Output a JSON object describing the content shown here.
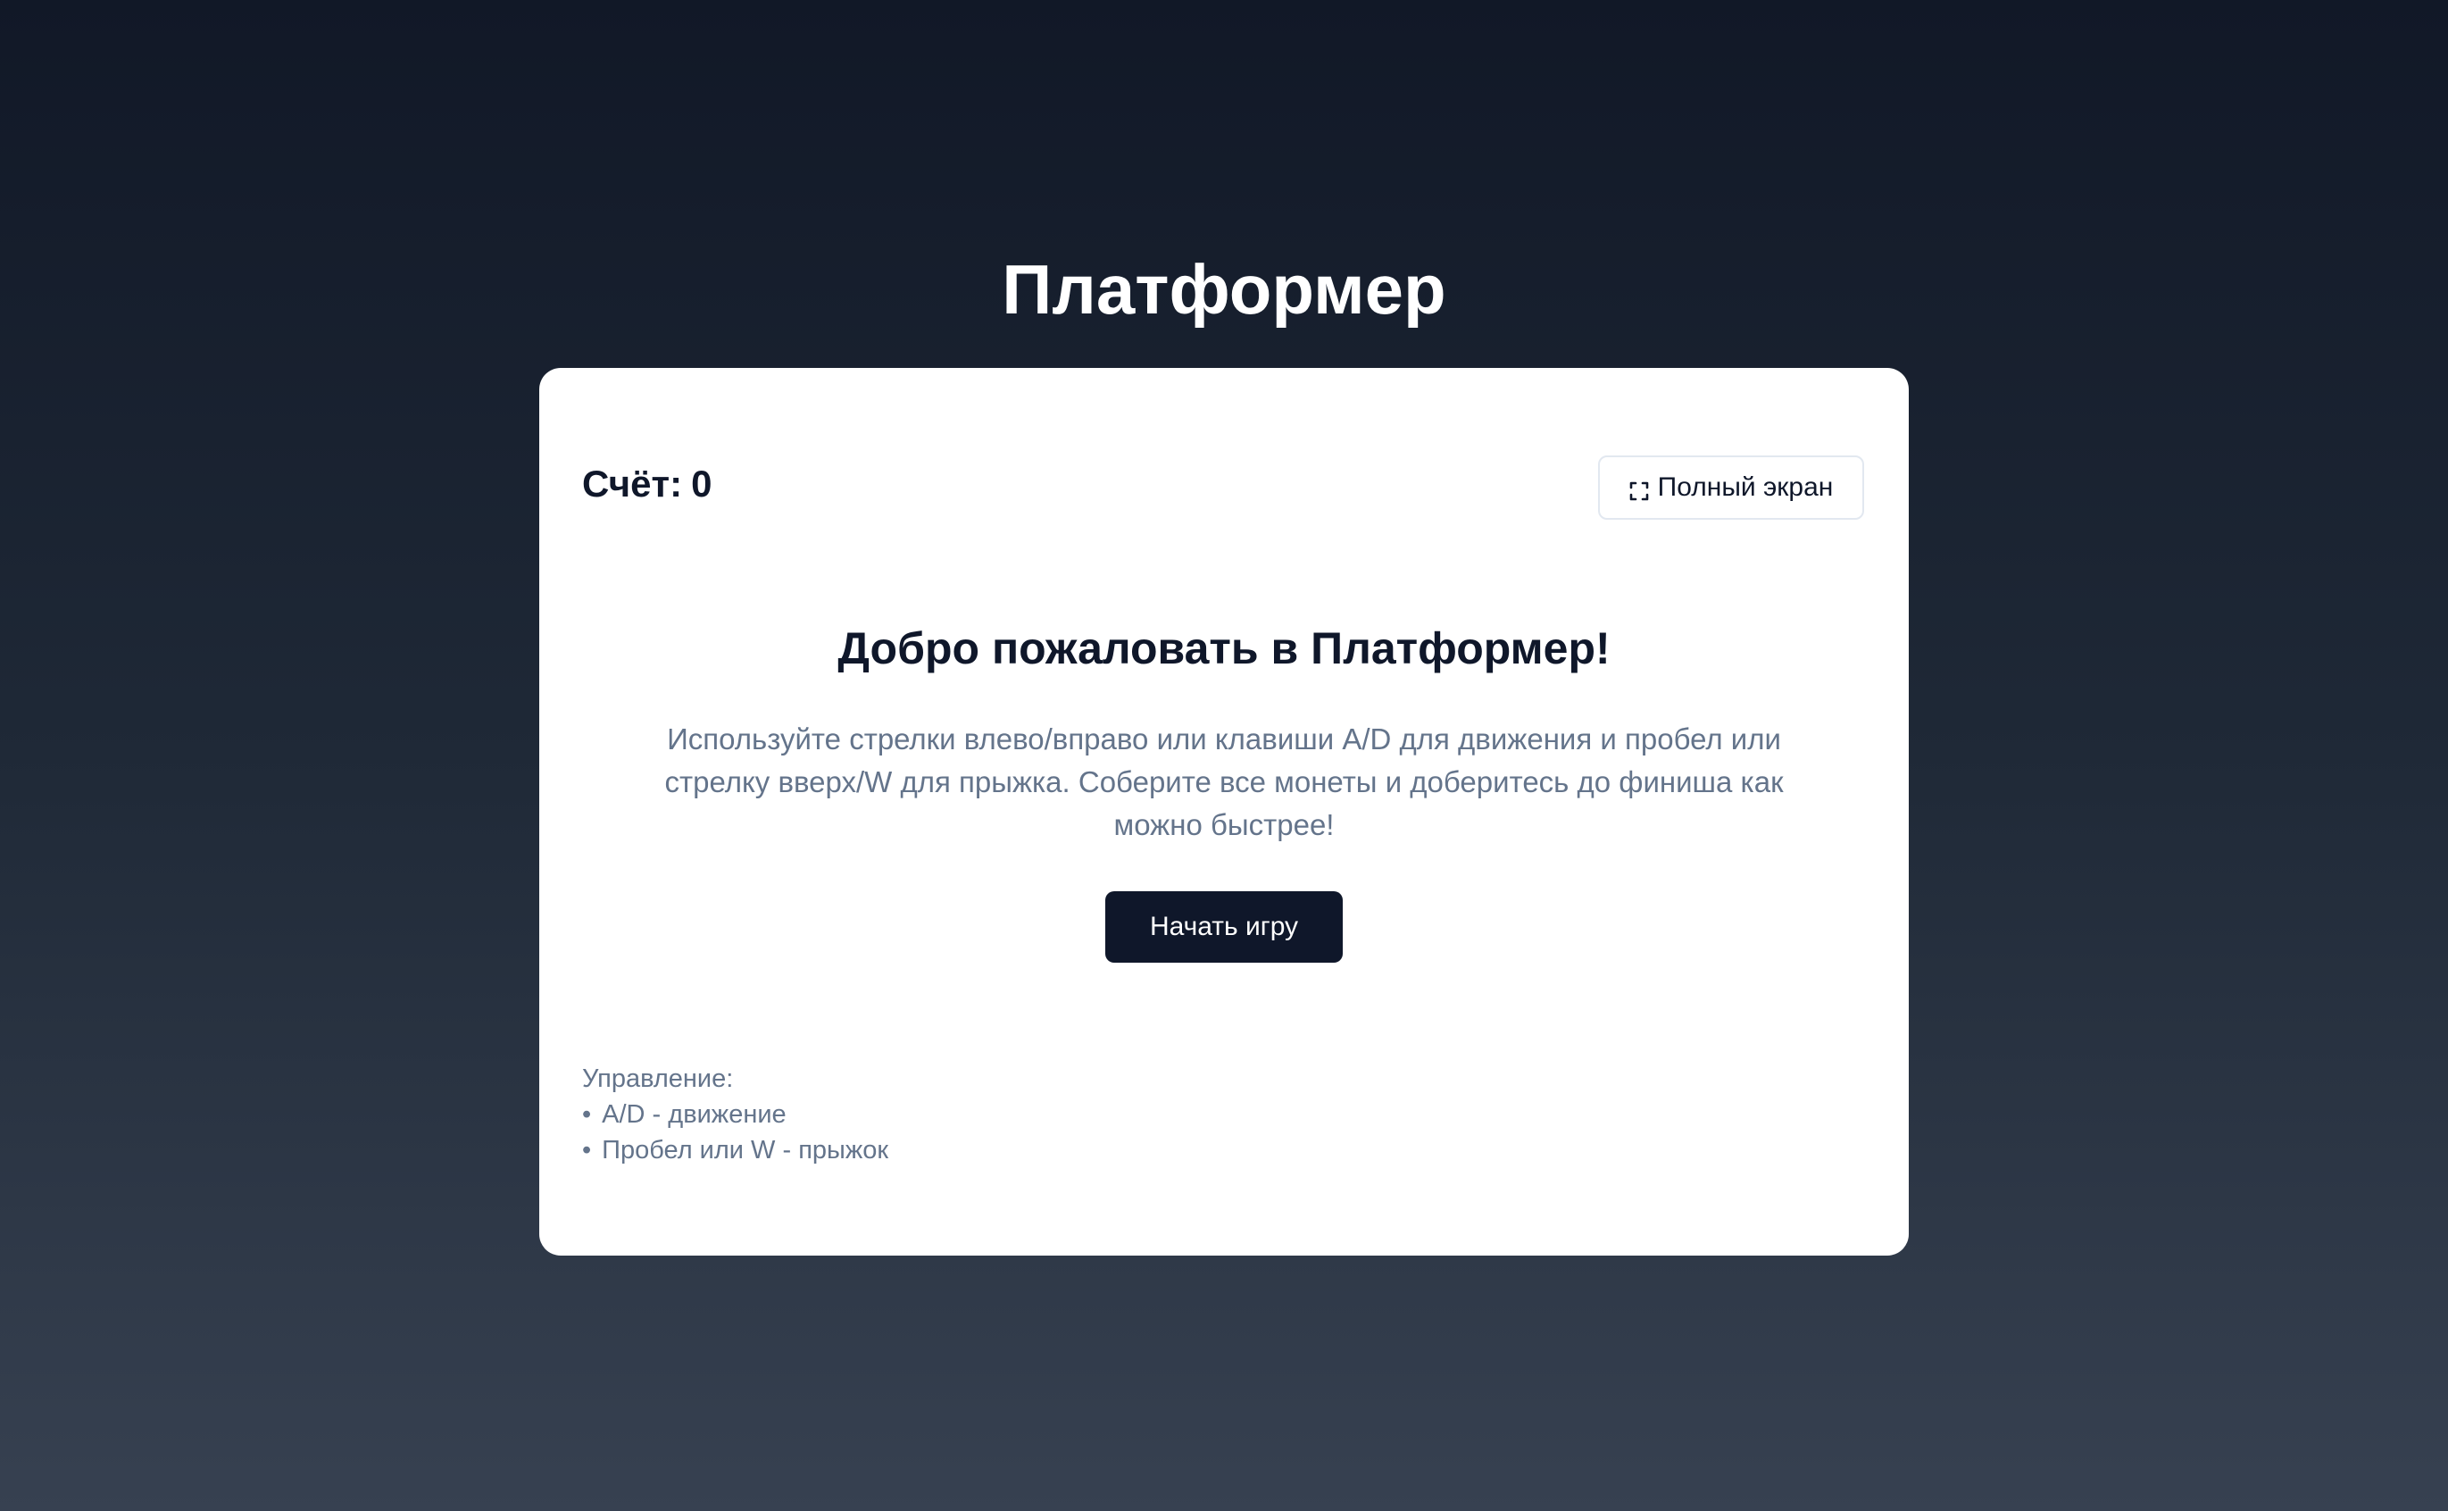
{
  "page": {
    "title": "Платформер"
  },
  "hud": {
    "score_label": "Счёт:",
    "score_value": "0",
    "fullscreen_label": "Полный экран",
    "fullscreen_icon": "fullscreen-icon"
  },
  "welcome": {
    "heading": "Добро пожаловать в Платформер!",
    "instructions": "Используйте стрелки влево/вправо или клавиши A/D для движения и пробел или стрелку вверх/W для прыжка. Соберите все монеты и доберитесь до финиша как можно быстрее!",
    "start_label": "Начать игру"
  },
  "controls": {
    "title": "Управление:",
    "items": [
      "A/D - движение",
      "Пробел или W - прыжок"
    ]
  },
  "colors": {
    "background_top": "#111827",
    "background_bottom": "#374151",
    "card": "#ffffff",
    "primary": "#0f172a",
    "muted_text": "#64748b"
  }
}
